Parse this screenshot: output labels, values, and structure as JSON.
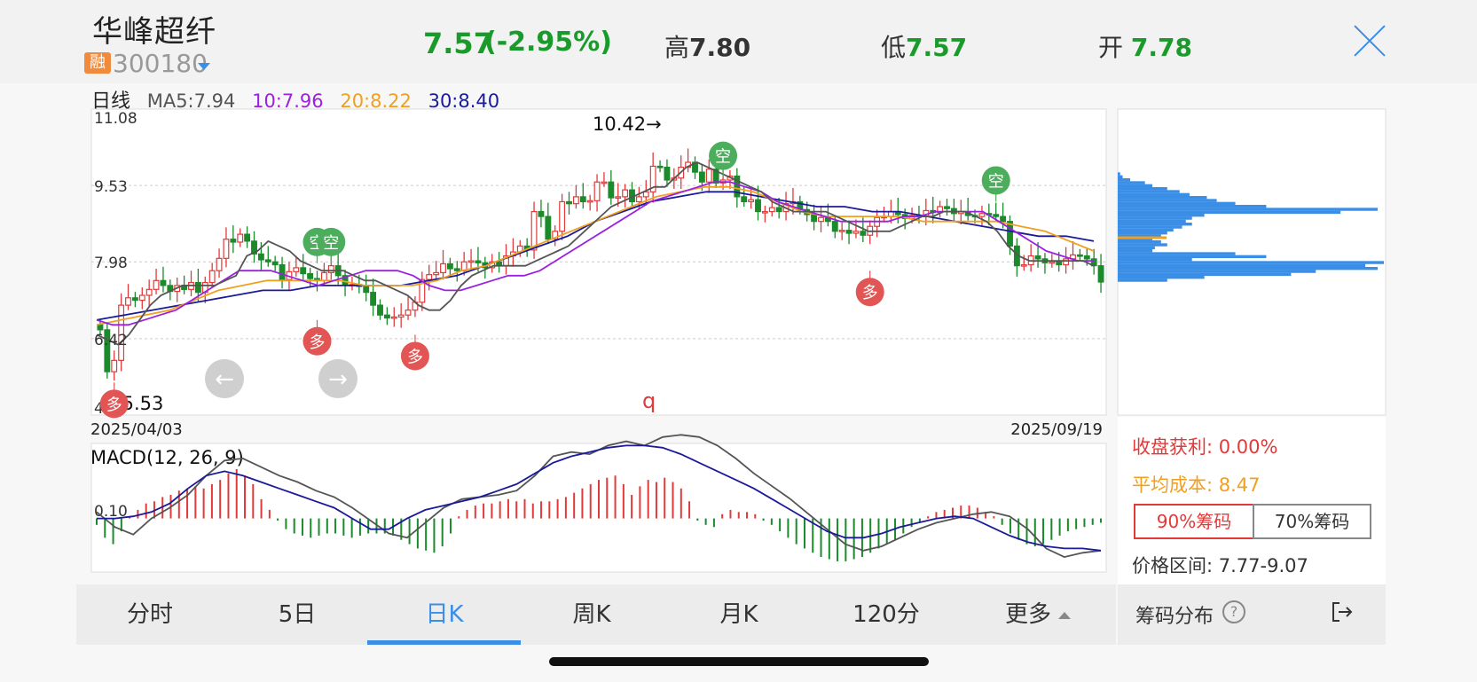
{
  "header": {
    "stock_name": "华峰超纤",
    "badge": "融",
    "code": "300180",
    "price": "7.57",
    "change": "(-2.95%)",
    "high_label": "高",
    "high_value": "7.80",
    "low_label": "低",
    "low_value": "7.57",
    "open_label": "开",
    "open_value": "7.78"
  },
  "ma_legend": {
    "period": "日线",
    "ma5": "MA5:7.94",
    "ma10": "10:7.96",
    "ma20": "20:8.22",
    "ma30": "30:8.40"
  },
  "colors": {
    "up": "#e23a3a",
    "down": "#1a8a2a",
    "ma5": "#555555",
    "ma10": "#9b20e0",
    "ma20": "#f0a020",
    "ma30": "#1a1a9a",
    "chip": "#3a8ee6",
    "chip_avg": "#f0a020",
    "macd_dif": "#555555",
    "macd_dea": "#1a1a9a"
  },
  "chart_data": {
    "type": "candlestick",
    "start_date": "2025/04/03",
    "end_date": "2025/09/19",
    "ylim": [
      4.87,
      11.08
    ],
    "y_ticks": [
      "11.08",
      "9.53",
      "7.98",
      "6.42",
      "4.87"
    ],
    "max_label": "10.42→",
    "min_label": "←5.53",
    "stray_label": "q",
    "signals": [
      {
        "label": "多",
        "index": 2,
        "price": 5.53,
        "kind": "buy"
      },
      {
        "label": "多",
        "index": 31,
        "price": 6.8,
        "kind": "buy"
      },
      {
        "label": "空",
        "index": 31,
        "price": 7.95,
        "kind": "sell"
      },
      {
        "label": "空",
        "index": 33,
        "price": 7.95,
        "kind": "sell"
      },
      {
        "label": "多",
        "index": 45,
        "price": 6.5,
        "kind": "buy"
      },
      {
        "label": "空",
        "index": 89,
        "price": 9.7,
        "kind": "sell"
      },
      {
        "label": "多",
        "index": 110,
        "price": 7.8,
        "kind": "buy"
      },
      {
        "label": "空",
        "index": 128,
        "price": 9.2,
        "kind": "sell"
      }
    ],
    "close": [
      6.6,
      5.75,
      5.98,
      7.1,
      7.25,
      7.2,
      7.3,
      7.42,
      7.6,
      7.5,
      7.38,
      7.5,
      7.42,
      7.56,
      7.36,
      7.56,
      7.8,
      8.05,
      8.44,
      8.38,
      8.54,
      8.4,
      8.14,
      8.02,
      7.98,
      7.92,
      7.62,
      7.78,
      7.86,
      7.74,
      7.64,
      7.6,
      7.76,
      7.9,
      7.7,
      7.5,
      7.52,
      7.48,
      7.36,
      7.1,
      6.9,
      6.84,
      6.86,
      6.9,
      7.0,
      7.16,
      7.62,
      7.72,
      7.76,
      7.94,
      7.84,
      7.8,
      7.98,
      8.0,
      7.96,
      7.86,
      7.98,
      7.9,
      8.1,
      8.18,
      8.3,
      8.22,
      9.0,
      8.9,
      8.44,
      8.6,
      9.2,
      9.16,
      9.3,
      9.2,
      9.22,
      9.6,
      9.6,
      9.28,
      9.3,
      9.44,
      9.2,
      9.3,
      9.4,
      9.92,
      9.9,
      9.64,
      9.68,
      9.9,
      10.0,
      9.8,
      9.6,
      9.86,
      9.58,
      9.64,
      9.72,
      9.3,
      9.2,
      9.24,
      9.0,
      9.0,
      9.08,
      9.0,
      9.16,
      9.2,
      9.04,
      8.94,
      8.8,
      8.88,
      8.8,
      8.6,
      8.62,
      8.56,
      8.6,
      8.52,
      8.7,
      8.88,
      8.9,
      9.0,
      8.94,
      8.86,
      8.92,
      8.9,
      9.02,
      8.98,
      9.1,
      9.06,
      8.96,
      9.0,
      8.92,
      8.9,
      8.96,
      8.94,
      8.9,
      8.8,
      8.3,
      7.9,
      7.92,
      8.1,
      8.04,
      7.96,
      7.98,
      7.92,
      8.04,
      8.12,
      8.1,
      8.04,
      7.9,
      7.57
    ],
    "ma5_line": [
      6.5,
      6.4,
      6.3,
      6.5,
      6.8,
      7.1,
      7.3,
      7.4,
      7.5,
      7.5,
      7.5,
      7.5,
      7.6,
      7.7,
      8.1,
      8.2,
      8.4,
      8.3,
      8.2,
      8.0,
      7.9,
      7.8,
      7.8,
      7.8,
      7.7,
      7.6,
      7.6,
      7.5,
      7.4,
      7.3,
      7.1,
      7.0,
      7.0,
      7.2,
      7.5,
      7.7,
      7.8,
      7.9,
      7.9,
      7.9,
      7.9,
      8.0,
      8.1,
      8.2,
      8.3,
      8.5,
      8.7,
      8.9,
      9.1,
      9.2,
      9.3,
      9.4,
      9.5,
      9.5,
      9.7,
      9.9,
      10.0,
      9.9,
      9.8,
      9.7,
      9.6,
      9.5,
      9.4,
      9.2,
      9.1,
      9.0,
      9.0,
      9.0,
      9.0,
      8.9,
      8.8,
      8.7,
      8.6,
      8.6,
      8.6,
      8.7,
      8.8,
      8.9,
      8.9,
      9.0,
      9.0,
      9.0,
      8.9,
      8.8,
      8.6,
      8.3,
      8.1,
      8.0,
      8.0,
      8.0,
      8.0,
      8.0,
      8.0,
      7.9
    ],
    "ma10_line": [
      6.8,
      6.7,
      6.7,
      6.8,
      6.9,
      7.0,
      7.2,
      7.4,
      7.6,
      7.8,
      7.8,
      7.8,
      7.7,
      7.6,
      7.5,
      7.6,
      7.7,
      7.8,
      7.8,
      7.8,
      7.7,
      7.5,
      7.4,
      7.4,
      7.5,
      7.6,
      7.7,
      7.7,
      7.8,
      8.0,
      8.2,
      8.4,
      8.6,
      8.8,
      9.0,
      9.2,
      9.3,
      9.4,
      9.5,
      9.6,
      9.6,
      9.5,
      9.4,
      9.2,
      9.1,
      9.0,
      8.9,
      8.8,
      8.8,
      8.8,
      8.8,
      8.9,
      8.9,
      9.0,
      9.0,
      9.0,
      9.0,
      8.8,
      8.6,
      8.4,
      8.2,
      8.1,
      8.0,
      8.0
    ],
    "ma20_line": [
      6.7,
      6.8,
      6.9,
      7.0,
      7.2,
      7.4,
      7.5,
      7.6,
      7.6,
      7.6,
      7.6,
      7.5,
      7.5,
      7.5,
      7.6,
      7.8,
      7.9,
      8.1,
      8.3,
      8.5,
      8.7,
      8.9,
      9.1,
      9.3,
      9.4,
      9.5,
      9.5,
      9.4,
      9.2,
      9.0,
      8.9,
      8.9,
      8.9,
      8.9,
      8.8,
      8.8,
      8.8,
      8.8,
      8.7,
      8.6,
      8.4,
      8.2
    ],
    "ma30_line": [
      6.8,
      6.9,
      7.0,
      7.1,
      7.2,
      7.3,
      7.4,
      7.4,
      7.5,
      7.5,
      7.5,
      7.5,
      7.6,
      7.7,
      7.9,
      8.1,
      8.3,
      8.5,
      8.8,
      9.0,
      9.2,
      9.3,
      9.4,
      9.4,
      9.3,
      9.2,
      9.1,
      9.1,
      9.0,
      9.0,
      8.9,
      8.8,
      8.7,
      8.6,
      8.5,
      8.5,
      8.4
    ],
    "chip_distribution": {
      "profit_label": "收盘获利: 0.00%",
      "avg_cost_label": "平均成本: 8.47",
      "range_label": "价格区间: 7.77-9.07",
      "avg_cost": 8.47,
      "prices": [
        9.76,
        9.7,
        9.64,
        9.58,
        9.52,
        9.46,
        9.4,
        9.34,
        9.28,
        9.22,
        9.16,
        9.1,
        9.04,
        8.98,
        8.92,
        8.86,
        8.8,
        8.74,
        8.68,
        8.62,
        8.56,
        8.5,
        8.44,
        8.38,
        8.32,
        8.26,
        8.2,
        8.14,
        8.08,
        8.02,
        7.96,
        7.9,
        7.84,
        7.78,
        7.72,
        7.66,
        7.6
      ],
      "volumes": [
        2,
        4,
        10,
        22,
        28,
        40,
        50,
        58,
        72,
        80,
        95,
        120,
        210,
        180,
        70,
        60,
        55,
        60,
        52,
        45,
        40,
        35,
        28,
        35,
        40,
        30,
        28,
        95,
        120,
        60,
        215,
        200,
        210,
        160,
        140,
        70,
        40
      ]
    },
    "macd": {
      "title": "MACD(12, 26, 9)",
      "tick": "0.10",
      "ylim": [
        -0.5,
        0.7
      ],
      "hist": [
        -0.06,
        -0.18,
        -0.24,
        -0.12,
        0.02,
        0.08,
        0.14,
        0.16,
        0.2,
        0.22,
        0.26,
        0.28,
        0.3,
        0.28,
        0.32,
        0.36,
        0.42,
        0.46,
        0.4,
        0.32,
        0.18,
        0.08,
        -0.02,
        -0.1,
        -0.14,
        -0.16,
        -0.18,
        -0.16,
        -0.14,
        -0.14,
        -0.16,
        -0.18,
        -0.16,
        -0.14,
        -0.14,
        -0.14,
        -0.16,
        -0.2,
        -0.24,
        -0.28,
        -0.3,
        -0.32,
        -0.26,
        -0.14,
        0.02,
        0.08,
        0.12,
        0.14,
        0.14,
        0.16,
        0.18,
        0.16,
        0.18,
        0.14,
        0.16,
        0.16,
        0.18,
        0.2,
        0.24,
        0.28,
        0.32,
        0.36,
        0.38,
        0.4,
        0.32,
        0.22,
        0.3,
        0.36,
        0.34,
        0.38,
        0.34,
        0.28,
        0.16,
        -0.02,
        -0.06,
        -0.08,
        0.04,
        0.08,
        0.06,
        0.06,
        0.04,
        -0.02,
        -0.06,
        -0.12,
        -0.18,
        -0.24,
        -0.28,
        -0.32,
        -0.36,
        -0.38,
        -0.4,
        -0.4,
        -0.38,
        -0.36,
        -0.32,
        -0.28,
        -0.24,
        -0.2,
        -0.14,
        -0.08,
        -0.04,
        0.02,
        0.06,
        0.08,
        0.1,
        0.12,
        0.12,
        0.1,
        0.06,
        0.02,
        -0.06,
        -0.14,
        -0.2,
        -0.24,
        -0.26,
        -0.24,
        -0.2,
        -0.16,
        -0.12,
        -0.1,
        -0.08,
        -0.06,
        -0.04
      ],
      "dif": [
        0.06,
        -0.08,
        -0.15,
        0.0,
        0.1,
        0.22,
        0.4,
        0.54,
        0.56,
        0.48,
        0.4,
        0.34,
        0.26,
        0.2,
        0.1,
        -0.02,
        -0.14,
        -0.18,
        -0.04,
        0.1,
        0.18,
        0.2,
        0.22,
        0.26,
        0.4,
        0.58,
        0.62,
        0.6,
        0.68,
        0.72,
        0.68,
        0.76,
        0.78,
        0.76,
        0.68,
        0.56,
        0.42,
        0.3,
        0.18,
        0.04,
        -0.1,
        -0.24,
        -0.3,
        -0.26,
        -0.18,
        -0.1,
        -0.04,
        0.0,
        0.04,
        0.06,
        0.02,
        -0.1,
        -0.28,
        -0.36,
        -0.32,
        -0.3
      ],
      "dea": [
        0.0,
        0.0,
        0.02,
        0.06,
        0.14,
        0.28,
        0.4,
        0.44,
        0.4,
        0.34,
        0.28,
        0.22,
        0.16,
        0.1,
        0.0,
        -0.1,
        -0.1,
        0.0,
        0.08,
        0.12,
        0.16,
        0.2,
        0.26,
        0.32,
        0.42,
        0.52,
        0.58,
        0.62,
        0.66,
        0.68,
        0.68,
        0.66,
        0.6,
        0.52,
        0.44,
        0.36,
        0.28,
        0.18,
        0.08,
        -0.02,
        -0.12,
        -0.18,
        -0.18,
        -0.14,
        -0.08,
        -0.04,
        0.0,
        0.02,
        0.0,
        -0.08,
        -0.16,
        -0.22,
        -0.26,
        -0.28,
        -0.28,
        -0.3
      ]
    }
  },
  "tabs": [
    "分时",
    "5日",
    "日K",
    "周K",
    "月K",
    "120分",
    "更多"
  ],
  "active_tab": "日K",
  "chip_panel": {
    "btn90": "90%筹码",
    "btn70": "70%筹码",
    "footer_label": "筹码分布",
    "help": "?"
  }
}
